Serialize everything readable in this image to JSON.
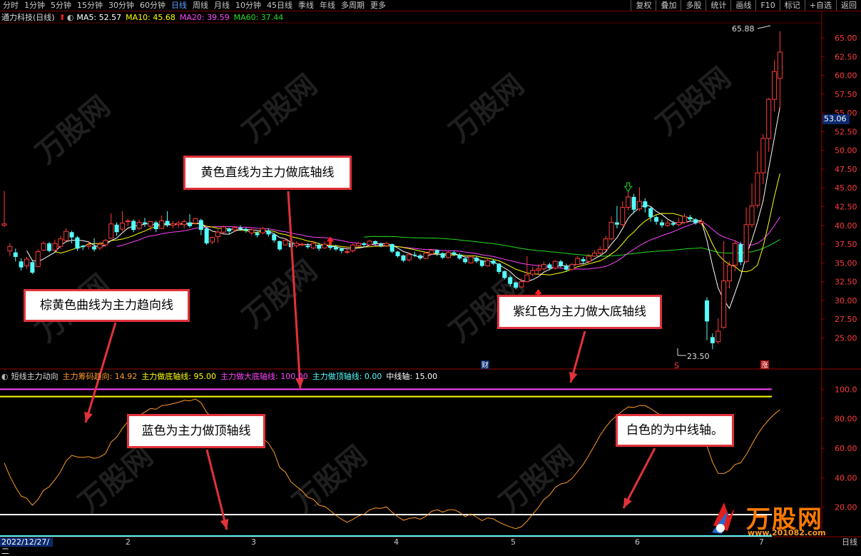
{
  "toolbar": {
    "periods": [
      "分时",
      "1分钟",
      "5分钟",
      "15分钟",
      "30分钟",
      "60分钟",
      "日线",
      "周线",
      "月线",
      "10分钟",
      "45日线",
      "季线",
      "年线",
      "多周期",
      "更多"
    ],
    "active_period": "日线",
    "right_buttons": [
      "复权",
      "叠加",
      "多股",
      "统计",
      "画线",
      "F10",
      "标记",
      "+自选",
      "返回"
    ]
  },
  "stock": {
    "title": "通力科技(日线)",
    "ma5": "MA5: 52.57",
    "ma10": "MA10: 45.68",
    "ma20": "MA20: 39.59",
    "ma60": "MA60: 37.44"
  },
  "colors": {
    "ma5": "#ffffff",
    "ma10": "#ffff00",
    "ma20": "#ff44ff",
    "ma60": "#22dd22",
    "up": "#ff3b3b",
    "down": "#54ffff",
    "trend": "#ff9a2a"
  },
  "price_axis": {
    "ticks": [
      "65.00",
      "62.50",
      "60.00",
      "57.50",
      "55.00",
      "52.50",
      "50.00",
      "47.50",
      "45.00",
      "42.50",
      "40.00",
      "37.50",
      "35.00",
      "32.50",
      "30.00",
      "27.50",
      "25.00"
    ],
    "current": "53.06",
    "high_label": "65.88",
    "low_label": "23.50"
  },
  "indicator": {
    "name": "短线主力动向",
    "trend": "主力筹码趋向: 14.92",
    "bottom": "主力做底轴线: 95.00",
    "big_bottom": "主力做大底轴线: 100.00",
    "top": "主力做顶轴线: 0.00",
    "mid": "中线轴: 15.00",
    "ticks": [
      "100.0",
      "80.00",
      "60.00",
      "40.00",
      "20.00"
    ]
  },
  "x_axis": {
    "start": "2022/12/27/二",
    "labels": [
      "2",
      "3",
      "4",
      "5",
      "6",
      "7"
    ],
    "period": "日线"
  },
  "markers": {
    "cai": "财",
    "s": "S",
    "zhang": "涨"
  },
  "annotations": {
    "yellow": "黄色直线为主力做底轴线",
    "brown": "棕黄色曲线为主力趋向线",
    "purple": "紫红色为主力做大底轴线",
    "blue": "蓝色为主力做顶轴线",
    "white": "白色的为中线轴。"
  },
  "logo": {
    "text": "万股网",
    "url": "www.201082.com"
  },
  "watermark": {
    "text": "万股网"
  },
  "chart_data": {
    "type": "candlestick",
    "title": "通力科技(日线)",
    "ylim": [
      22,
      67
    ],
    "current_price": 53.06,
    "high": 65.88,
    "low": 23.5,
    "candles": [
      [
        0,
        40.0,
        40.2,
        44.6,
        39.8
      ],
      [
        1,
        36.6,
        37.2,
        37.6,
        35.9
      ],
      [
        2,
        36.4,
        35.8,
        36.9,
        35.2
      ],
      [
        3,
        35.2,
        34.4,
        35.6,
        34.0
      ],
      [
        4,
        34.6,
        35.5,
        35.8,
        34.2
      ],
      [
        5,
        35.1,
        33.7,
        35.3,
        33.5
      ],
      [
        6,
        34.5,
        36.5,
        36.8,
        34.4
      ],
      [
        7,
        36.7,
        37.6,
        37.9,
        36.6
      ],
      [
        8,
        37.6,
        36.6,
        37.8,
        36.4
      ],
      [
        9,
        36.7,
        37.6,
        38.1,
        36.5
      ],
      [
        10,
        37.2,
        38.2,
        38.6,
        36.9
      ],
      [
        11,
        38.0,
        39.2,
        39.6,
        37.9
      ],
      [
        12,
        39.1,
        38.4,
        39.3,
        37.6
      ],
      [
        13,
        38.4,
        36.9,
        38.6,
        36.6
      ],
      [
        14,
        37.3,
        37.1,
        37.4,
        36.7
      ],
      [
        15,
        37.2,
        37.4,
        37.9,
        36.8
      ],
      [
        16,
        37.2,
        36.8,
        38.3,
        36.5
      ],
      [
        17,
        37.0,
        37.5,
        37.8,
        36.7
      ],
      [
        18,
        37.4,
        38.0,
        38.2,
        37.1
      ],
      [
        19,
        38.3,
        40.2,
        41.6,
        38.2
      ],
      [
        20,
        40.1,
        39.1,
        40.4,
        38.6
      ],
      [
        21,
        39.5,
        40.3,
        41.9,
        39.2
      ],
      [
        22,
        40.5,
        40.6,
        40.9,
        39.9
      ],
      [
        23,
        40.6,
        39.4,
        40.8,
        39.1
      ],
      [
        24,
        39.6,
        40.4,
        40.8,
        39.4
      ],
      [
        25,
        40.4,
        40.2,
        41.0,
        39.8
      ],
      [
        26,
        39.9,
        40.5,
        40.6,
        39.3
      ],
      [
        27,
        40.4,
        39.5,
        40.6,
        39.1
      ],
      [
        28,
        39.6,
        40.6,
        41.3,
        39.5
      ],
      [
        29,
        40.6,
        40.0,
        41.9,
        39.8
      ],
      [
        30,
        40.0,
        40.2,
        40.6,
        39.6
      ],
      [
        31,
        40.1,
        40.3,
        40.6,
        39.7
      ],
      [
        32,
        40.1,
        40.5,
        40.8,
        39.6
      ],
      [
        33,
        40.4,
        39.9,
        41.5,
        39.7
      ],
      [
        34,
        40.3,
        40.9,
        41.0,
        40.1
      ],
      [
        35,
        40.7,
        39.4,
        40.9,
        38.7
      ],
      [
        36,
        39.6,
        37.6,
        39.7,
        37.4
      ],
      [
        37,
        37.8,
        38.4,
        38.5,
        37.5
      ],
      [
        38,
        38.5,
        39.1,
        39.5,
        37.7
      ],
      [
        39,
        39.1,
        39.8,
        40.0,
        38.9
      ],
      [
        40,
        39.6,
        39.2,
        39.7,
        38.9
      ],
      [
        41,
        39.4,
        39.7,
        39.9,
        39.2
      ],
      [
        42,
        39.7,
        39.5,
        40.0,
        39.3
      ],
      [
        43,
        39.5,
        39.3,
        39.7,
        39.0
      ],
      [
        44,
        39.0,
        39.4,
        39.6,
        38.7
      ],
      [
        45,
        39.0,
        38.7,
        39.2,
        38.4
      ],
      [
        46,
        39.0,
        39.6,
        39.8,
        38.8
      ],
      [
        47,
        39.3,
        38.8,
        39.6,
        38.5
      ],
      [
        48,
        38.8,
        38.0,
        39.0,
        37.7
      ],
      [
        49,
        37.9,
        36.8,
        38.0,
        36.6
      ],
      [
        50,
        37.4,
        38.0,
        38.3,
        37.3
      ],
      [
        51,
        37.7,
        37.1,
        37.9,
        36.9
      ],
      [
        52,
        37.3,
        37.6,
        37.9,
        37.0
      ],
      [
        53,
        37.4,
        37.5,
        37.7,
        37.2
      ],
      [
        54,
        37.3,
        37.1,
        37.6,
        36.9
      ],
      [
        55,
        37.0,
        37.6,
        37.9,
        36.8
      ],
      [
        56,
        37.4,
        36.9,
        37.7,
        36.6
      ],
      [
        57,
        37.0,
        37.5,
        37.9,
        36.9
      ],
      [
        58,
        37.3,
        37.0,
        37.8,
        36.7
      ],
      [
        59,
        37.1,
        36.8,
        37.4,
        36.6
      ],
      [
        60,
        36.9,
        36.6,
        37.0,
        36.3
      ],
      [
        61,
        36.5,
        36.5,
        37.2,
        36.2
      ],
      [
        62,
        36.6,
        37.4,
        37.6,
        36.4
      ],
      [
        63,
        37.3,
        37.6,
        37.8,
        37.1
      ],
      [
        64,
        37.6,
        37.4,
        37.8,
        37.2
      ],
      [
        65,
        37.4,
        37.9,
        38.1,
        37.3
      ],
      [
        66,
        37.9,
        37.6,
        38.0,
        37.3
      ],
      [
        67,
        37.5,
        37.3,
        37.7,
        37.1
      ],
      [
        68,
        37.3,
        37.6,
        37.8,
        37.1
      ],
      [
        69,
        37.5,
        36.5,
        37.6,
        36.3
      ],
      [
        70,
        36.5,
        35.9,
        36.6,
        35.7
      ],
      [
        71,
        36.0,
        35.3,
        36.1,
        35.1
      ],
      [
        72,
        35.4,
        36.1,
        36.4,
        35.2
      ],
      [
        73,
        36.1,
        36.0,
        36.5,
        35.8
      ],
      [
        74,
        36.0,
        35.6,
        36.2,
        35.4
      ],
      [
        75,
        35.6,
        36.3,
        36.5,
        35.5
      ],
      [
        76,
        36.2,
        36.7,
        36.9,
        36.0
      ],
      [
        77,
        36.7,
        36.3,
        36.8,
        35.9
      ],
      [
        78,
        36.3,
        35.7,
        36.4,
        35.5
      ],
      [
        79,
        35.7,
        36.4,
        36.6,
        35.6
      ],
      [
        80,
        36.4,
        36.1,
        36.6,
        35.9
      ],
      [
        81,
        36.1,
        35.6,
        36.3,
        35.4
      ],
      [
        82,
        35.6,
        35.1,
        35.8,
        34.9
      ],
      [
        83,
        35.0,
        35.8,
        36.0,
        34.9
      ],
      [
        84,
        35.7,
        35.2,
        35.9,
        35.0
      ],
      [
        85,
        35.3,
        34.6,
        35.4,
        34.4
      ],
      [
        86,
        34.6,
        35.3,
        35.5,
        34.5
      ],
      [
        87,
        35.3,
        34.9,
        35.5,
        34.7
      ],
      [
        88,
        34.9,
        33.8,
        35.0,
        33.5
      ],
      [
        89,
        33.9,
        33.0,
        34.0,
        32.8
      ],
      [
        90,
        33.1,
        32.2,
        33.3,
        31.9
      ],
      [
        91,
        32.4,
        31.7,
        32.5,
        31.5
      ],
      [
        92,
        31.8,
        32.5,
        33.0,
        31.7
      ],
      [
        93,
        32.5,
        33.4,
        35.9,
        32.4
      ],
      [
        94,
        33.5,
        34.0,
        34.5,
        33.2
      ],
      [
        95,
        34.0,
        34.2,
        34.8,
        33.4
      ],
      [
        96,
        34.2,
        34.8,
        35.2,
        34.0
      ],
      [
        97,
        34.8,
        34.3,
        35.0,
        34.0
      ],
      [
        98,
        34.3,
        35.2,
        35.4,
        34.1
      ],
      [
        99,
        35.2,
        34.6,
        35.4,
        34.4
      ],
      [
        100,
        34.6,
        34.1,
        34.9,
        33.8
      ],
      [
        101,
        34.1,
        34.8,
        35.0,
        34.0
      ],
      [
        102,
        34.8,
        35.6,
        35.9,
        34.7
      ],
      [
        103,
        35.5,
        35.2,
        35.8,
        34.9
      ],
      [
        104,
        35.2,
        35.9,
        36.2,
        35.0
      ],
      [
        105,
        35.9,
        36.3,
        36.7,
        35.8
      ],
      [
        106,
        36.3,
        36.8,
        37.2,
        36.1
      ],
      [
        107,
        36.8,
        38.2,
        38.6,
        36.6
      ],
      [
        108,
        38.2,
        40.4,
        41.2,
        38.0
      ],
      [
        109,
        40.4,
        40.1,
        42.6,
        39.6
      ],
      [
        110,
        40.1,
        42.4,
        43.2,
        39.9
      ],
      [
        111,
        42.4,
        43.8,
        44.6,
        42.0
      ],
      [
        112,
        43.8,
        42.1,
        44.2,
        41.6
      ],
      [
        113,
        42.2,
        43.2,
        45.1,
        41.9
      ],
      [
        114,
        43.2,
        42.4,
        43.6,
        41.7
      ],
      [
        115,
        42.3,
        41.1,
        42.5,
        40.5
      ],
      [
        116,
        41.1,
        40.5,
        41.3,
        40.1
      ],
      [
        117,
        40.4,
        40.0,
        40.8,
        39.7
      ],
      [
        118,
        40.0,
        40.3,
        40.7,
        39.8
      ],
      [
        119,
        40.3,
        40.1,
        40.6,
        39.9
      ],
      [
        120,
        40.1,
        40.4,
        41.0,
        39.9
      ],
      [
        121,
        40.4,
        41.2,
        41.6,
        40.2
      ],
      [
        122,
        41.1,
        40.8,
        41.4,
        40.5
      ],
      [
        123,
        40.8,
        40.3,
        41.0,
        40.1
      ],
      [
        124,
        40.3,
        40.5,
        40.9,
        40.0
      ],
      [
        125,
        30.0,
        27.2,
        30.4,
        24.7
      ],
      [
        126,
        25.1,
        24.3,
        25.6,
        23.5
      ],
      [
        127,
        24.5,
        25.9,
        27.6,
        24.2
      ],
      [
        128,
        26.4,
        32.6,
        37.9,
        26.2
      ],
      [
        129,
        32.6,
        34.7,
        35.2,
        31.6
      ],
      [
        130,
        34.7,
        37.6,
        37.9,
        33.9
      ],
      [
        131,
        37.5,
        35.1,
        37.8,
        34.7
      ],
      [
        132,
        35.2,
        40.1,
        42.4,
        35.0
      ],
      [
        133,
        40.1,
        42.6,
        45.6,
        39.7
      ],
      [
        134,
        42.7,
        47.0,
        49.9,
        42.3
      ],
      [
        135,
        47.0,
        51.6,
        52.2,
        45.5
      ],
      [
        136,
        51.6,
        56.8,
        57.0,
        49.8
      ],
      [
        137,
        56.8,
        60.5,
        62.0,
        55.2
      ],
      [
        138,
        59.6,
        63.1,
        65.88,
        55.5
      ]
    ],
    "indicator_series": {
      "name": "主力筹码趋向",
      "ylim": [
        0,
        105
      ],
      "bottom_axis": 95.0,
      "big_bottom_axis": 100.0,
      "top_axis": 0.0,
      "mid_axis": 15.0,
      "trend_last": 14.92
    }
  }
}
